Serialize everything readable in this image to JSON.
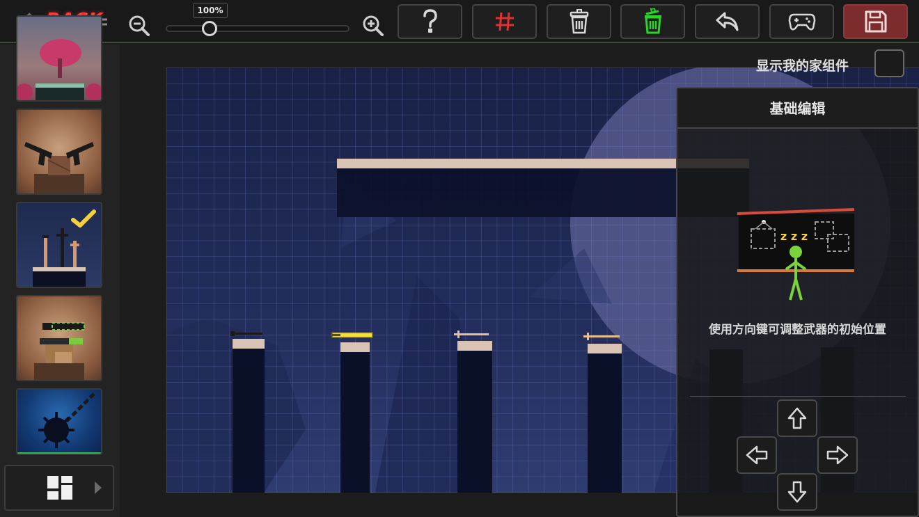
{
  "toolbar": {
    "back_label": "BACK",
    "zoom_value": "100%",
    "zoom_fraction": 0.24,
    "buttons": [
      {
        "icon": "question-icon",
        "color": "#d9d9d9"
      },
      {
        "icon": "grid-icon",
        "color": "#e23030"
      },
      {
        "icon": "trash-icon",
        "color": "#d9d9d9"
      },
      {
        "icon": "trash-green-icon",
        "color": "#27d627"
      },
      {
        "icon": "undo-icon",
        "color": "#d9d9d9"
      },
      {
        "icon": "gamepad-icon",
        "color": "#d9d9d9"
      },
      {
        "icon": "save-icon",
        "color": "#f0d8d8"
      }
    ]
  },
  "sidebar": {
    "thumbnails": [
      {
        "name": "tree-block-map"
      },
      {
        "name": "twin-pistols-map"
      },
      {
        "name": "sword-altar-map",
        "selected": true
      },
      {
        "name": "bazooka-crates-map"
      },
      {
        "name": "spiked-ball-map"
      }
    ]
  },
  "editor": {
    "show_my_home_label": "显示我的家组件"
  },
  "panel": {
    "title": "基础编辑",
    "tip": "使用方向键可调整武器的初始位置",
    "illustration_text": "z z z"
  },
  "colors": {
    "accent_red": "#ff3b3b",
    "accent_green": "#27d627",
    "platform": "#d8c3b5",
    "pillar": "#0b1029",
    "save_bg": "#7c2c2c"
  }
}
